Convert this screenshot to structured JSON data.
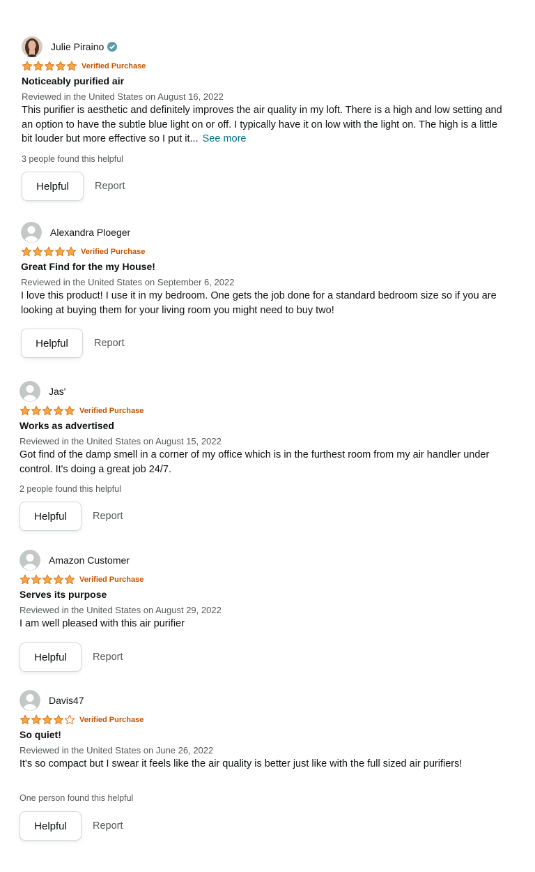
{
  "reviews": [
    {
      "name": "Julie Piraino",
      "avatar": "profile-photo",
      "verified_profile_icon": "verified-check-icon",
      "stars": 5,
      "verified": "Verified Purchase",
      "title": "Noticeably purified air",
      "date": "Reviewed in the United States on August 16, 2022",
      "body": "This purifier is aesthetic and definitely improves the air quality in my loft. There is a high and low setting and an option to have the subtle blue light on or off. I typically have it on low with the light on. The high is a little bit louder but more effective so I put it...",
      "see_more": "See more",
      "helpful_count": "3 people found this helpful",
      "helpful_label": "Helpful",
      "report_label": "Report"
    },
    {
      "name": "Alexandra Ploeger",
      "avatar": "default-avatar",
      "stars": 5,
      "verified": "Verified Purchase",
      "title": "Great Find for the my House!",
      "date": "Reviewed in the United States on September 6, 2022",
      "body": "I love this product! I use it in my bedroom. One gets the job done for a standard bedroom size so if you are looking at buying them for your living room you might need to buy two!",
      "helpful_label": "Helpful",
      "report_label": "Report"
    },
    {
      "name": "Jas'",
      "avatar": "default-avatar",
      "stars": 5,
      "verified": "Verified Purchase",
      "title": "Works as advertised",
      "date": "Reviewed in the United States on August 15, 2022",
      "body": "Got find of the damp smell in a corner of my office which is in the furthest room from my air handler under control. It's doing a great job 24/7.",
      "helpful_count": "2 people found this helpful",
      "helpful_label": "Helpful",
      "report_label": "Report"
    },
    {
      "name": "Amazon Customer",
      "avatar": "default-avatar",
      "stars": 5,
      "verified": "Verified Purchase",
      "title": "Serves its purpose",
      "date": "Reviewed in the United States on August 29, 2022",
      "body": "I am well pleased with this air purifier",
      "helpful_label": "Helpful",
      "report_label": "Report"
    },
    {
      "name": "Davis47",
      "avatar": "default-avatar",
      "stars": 4,
      "verified": "Verified Purchase",
      "title": "So quiet!",
      "date": "Reviewed in the United States on June 26, 2022",
      "body": "It's so compact but I swear it feels like the air quality is better just like with the full sized air purifiers!",
      "helpful_count": "One person found this helpful",
      "helpful_label": "Helpful",
      "report_label": "Report"
    }
  ],
  "colors": {
    "star": "#f3a847",
    "star_outline": "#de7921",
    "verified": "#c45500",
    "link": "#007185",
    "secondary_text": "#565959"
  }
}
